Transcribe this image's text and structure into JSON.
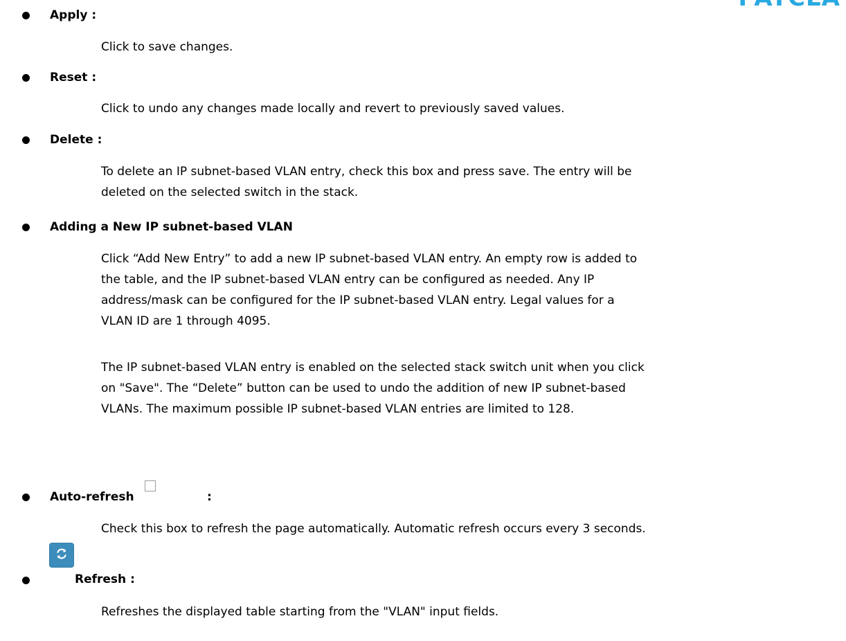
{
  "brand": {
    "fragment": "PATCLA"
  },
  "sections": {
    "apply": {
      "heading": "Apply :",
      "lines": [
        "Click to save changes."
      ]
    },
    "reset": {
      "heading": "Reset :",
      "lines": [
        "Click to undo any changes made locally and revert to previously saved values."
      ]
    },
    "delete": {
      "heading": "Delete :",
      "lines": [
        "To delete an IP subnet-based VLAN entry, check this box and press save. The entry will be",
        "deleted on the selected switch in the stack."
      ]
    },
    "adding": {
      "heading": "Adding a New IP subnet-based VLAN",
      "para1": [
        "Click “Add New Entry” to add a new IP subnet-based VLAN entry. An empty row is added to",
        "the table, and the IP subnet-based VLAN entry can be configured as needed. Any IP",
        "address/mask can be configured for the IP subnet-based VLAN entry. Legal values for a",
        "VLAN ID are 1 through 4095."
      ],
      "para2": [
        "The IP subnet-based VLAN entry is enabled on the selected stack switch unit when you click",
        "on \"Save\". The “Delete” button can be used to undo the addition of new IP subnet-based",
        "VLANs. The maximum possible IP subnet-based VLAN entries are limited to 128."
      ]
    },
    "autorefresh": {
      "heading": "Auto-refresh",
      "colon": ":",
      "checked": false,
      "lines": [
        "Check this box to refresh the page automatically. Automatic refresh occurs every 3 seconds."
      ]
    },
    "refresh": {
      "heading": "Refresh :",
      "icon": "refresh-icon",
      "button_color": "#3c8dbc",
      "lines": [
        "Refreshes the displayed table starting from the \"VLAN\" input fields."
      ]
    }
  }
}
